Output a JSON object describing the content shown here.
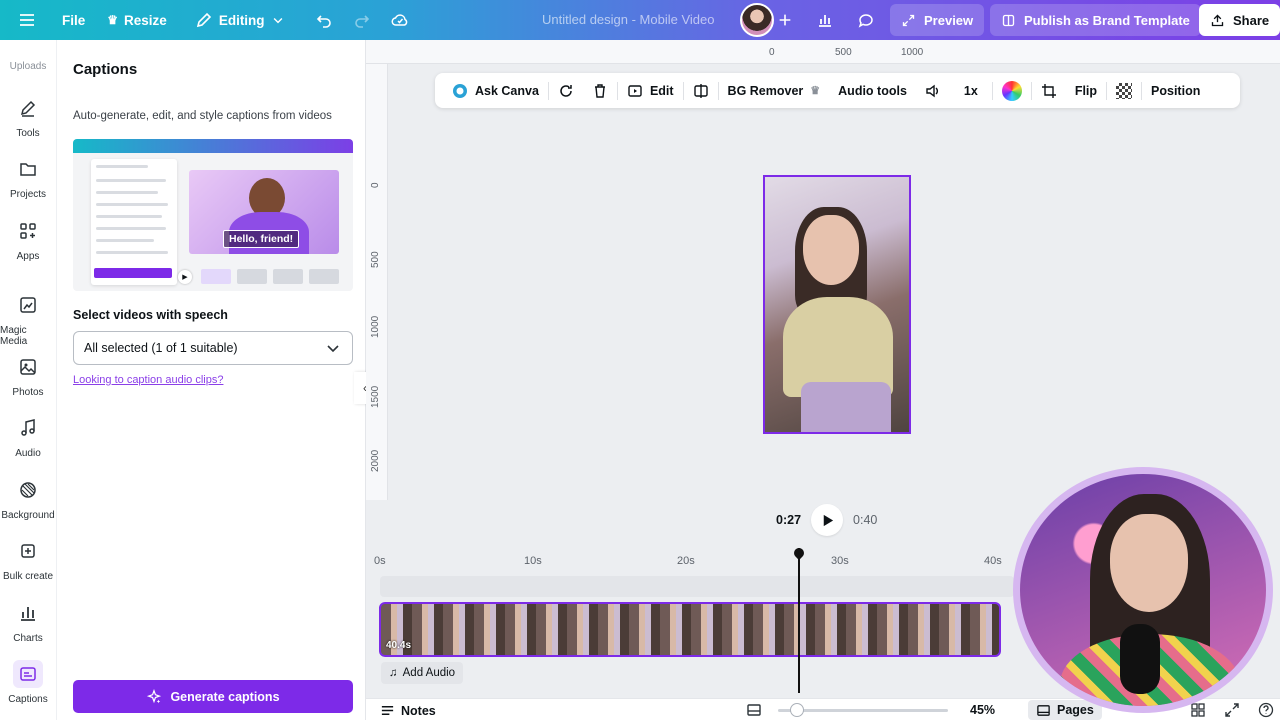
{
  "topbar": {
    "file": "File",
    "resize": "Resize",
    "editing": "Editing",
    "doc_title": "Untitled design - Mobile Video",
    "preview": "Preview",
    "publish": "Publish as Brand Template",
    "share": "Share"
  },
  "rail": {
    "uploads": "Uploads",
    "items": [
      {
        "label": "Tools",
        "icon": "pen-icon"
      },
      {
        "label": "Projects",
        "icon": "folder-icon"
      },
      {
        "label": "Apps",
        "icon": "apps-icon"
      },
      {
        "label": "Magic Media",
        "icon": "magic-media-icon"
      },
      {
        "label": "Photos",
        "icon": "photo-icon"
      },
      {
        "label": "Audio",
        "icon": "music-icon"
      },
      {
        "label": "Background",
        "icon": "background-icon"
      },
      {
        "label": "Bulk create",
        "icon": "bulk-create-icon"
      },
      {
        "label": "Charts",
        "icon": "chart-icon"
      },
      {
        "label": "Captions",
        "icon": "captions-icon"
      }
    ]
  },
  "panel": {
    "title": "Captions",
    "description": "Auto-generate, edit, and style captions from videos",
    "promo_caption": "Hello, friend!",
    "select_label": "Select videos with speech",
    "select_value": "All selected (1 of 1 suitable)",
    "audio_link": "Looking to caption audio clips?",
    "generate": "Generate captions"
  },
  "rulers": {
    "h": [
      "0",
      "500",
      "1000"
    ],
    "v": [
      "0",
      "500",
      "1000",
      "1500",
      "2000"
    ]
  },
  "context_toolbar": {
    "ask_canva": "Ask Canva",
    "edit": "Edit",
    "bg_remover": "BG Remover",
    "audio_tools": "Audio tools",
    "speed": "1x",
    "flip": "Flip",
    "position": "Position"
  },
  "playback": {
    "current": "0:27",
    "total": "0:40"
  },
  "timeline": {
    "ticks": [
      "0s",
      "10s",
      "20s",
      "30s",
      "40s"
    ],
    "clip_length": "40.4s",
    "add_audio": "Add Audio"
  },
  "bottom": {
    "notes": "Notes",
    "zoom": "45%",
    "zoom_fraction": 0.1,
    "pages": "Pages"
  },
  "colors": {
    "accent": "#7d2ae8",
    "topbar_start": "#16b9c8",
    "topbar_end": "#7c3fe6"
  }
}
